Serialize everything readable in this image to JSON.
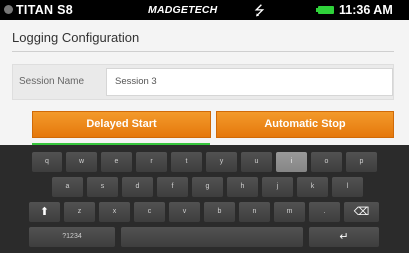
{
  "status_bar": {
    "device": "TITAN S8",
    "brand": "MADGETECH",
    "usb_icon": "usb-icon",
    "battery_icon": "battery-icon",
    "battery_color": "#2fd23a",
    "time": "11:36 AM"
  },
  "page": {
    "title": "Logging Configuration",
    "session_name_label": "Session Name",
    "session_name_value": "Session 3"
  },
  "buttons": {
    "delayed_start": "Delayed Start",
    "automatic_stop": "Automatic Stop",
    "accent_color": "#ef8a1c"
  },
  "keyboard": {
    "row1": [
      "q",
      "w",
      "e",
      "r",
      "t",
      "y",
      "u",
      "i",
      "o",
      "p"
    ],
    "row2": [
      "a",
      "s",
      "d",
      "f",
      "g",
      "h",
      "j",
      "k",
      "l"
    ],
    "row3": [
      "z",
      "x",
      "c",
      "v",
      "b",
      "n",
      "m",
      "."
    ],
    "shift_icon": "shift-icon",
    "backspace_icon": "backspace-icon",
    "enter_icon": "enter-icon",
    "symbols_label": "?1234",
    "pressed_key": "i"
  }
}
